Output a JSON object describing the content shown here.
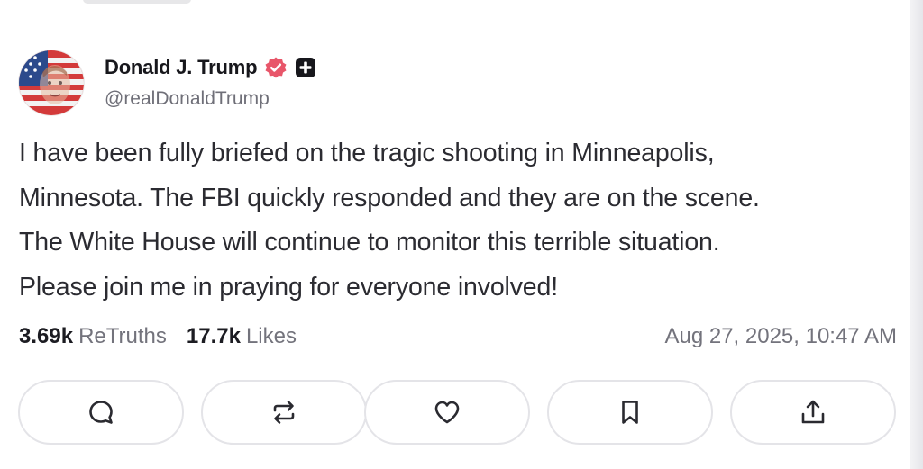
{
  "post": {
    "author": {
      "display_name": "Donald J. Trump",
      "handle": "@realDonaldTrump"
    },
    "text_lines": [
      "I have been fully briefed on the tragic shooting in Minneapolis,",
      "Minnesota. The FBI quickly responded and they are on the scene.",
      "The White House will continue to monitor this terrible situation.",
      "Please join me in praying for everyone involved!"
    ],
    "stats": {
      "retruths_count": "3.69k",
      "retruths_label": "ReTruths",
      "likes_count": "17.7k",
      "likes_label": "Likes"
    },
    "timestamp": "Aug 27, 2025, 10:47 AM",
    "actions": [
      {
        "icon": "reply-icon"
      },
      {
        "icon": "retruth-icon"
      },
      {
        "icon": "like-icon"
      },
      {
        "icon": "bookmark-icon"
      },
      {
        "icon": "share-icon"
      }
    ]
  },
  "colors": {
    "verified_badge": "#e8566a",
    "primary_text": "#1f1f24",
    "secondary_text": "#73737c",
    "button_border": "#e4e4e8"
  }
}
